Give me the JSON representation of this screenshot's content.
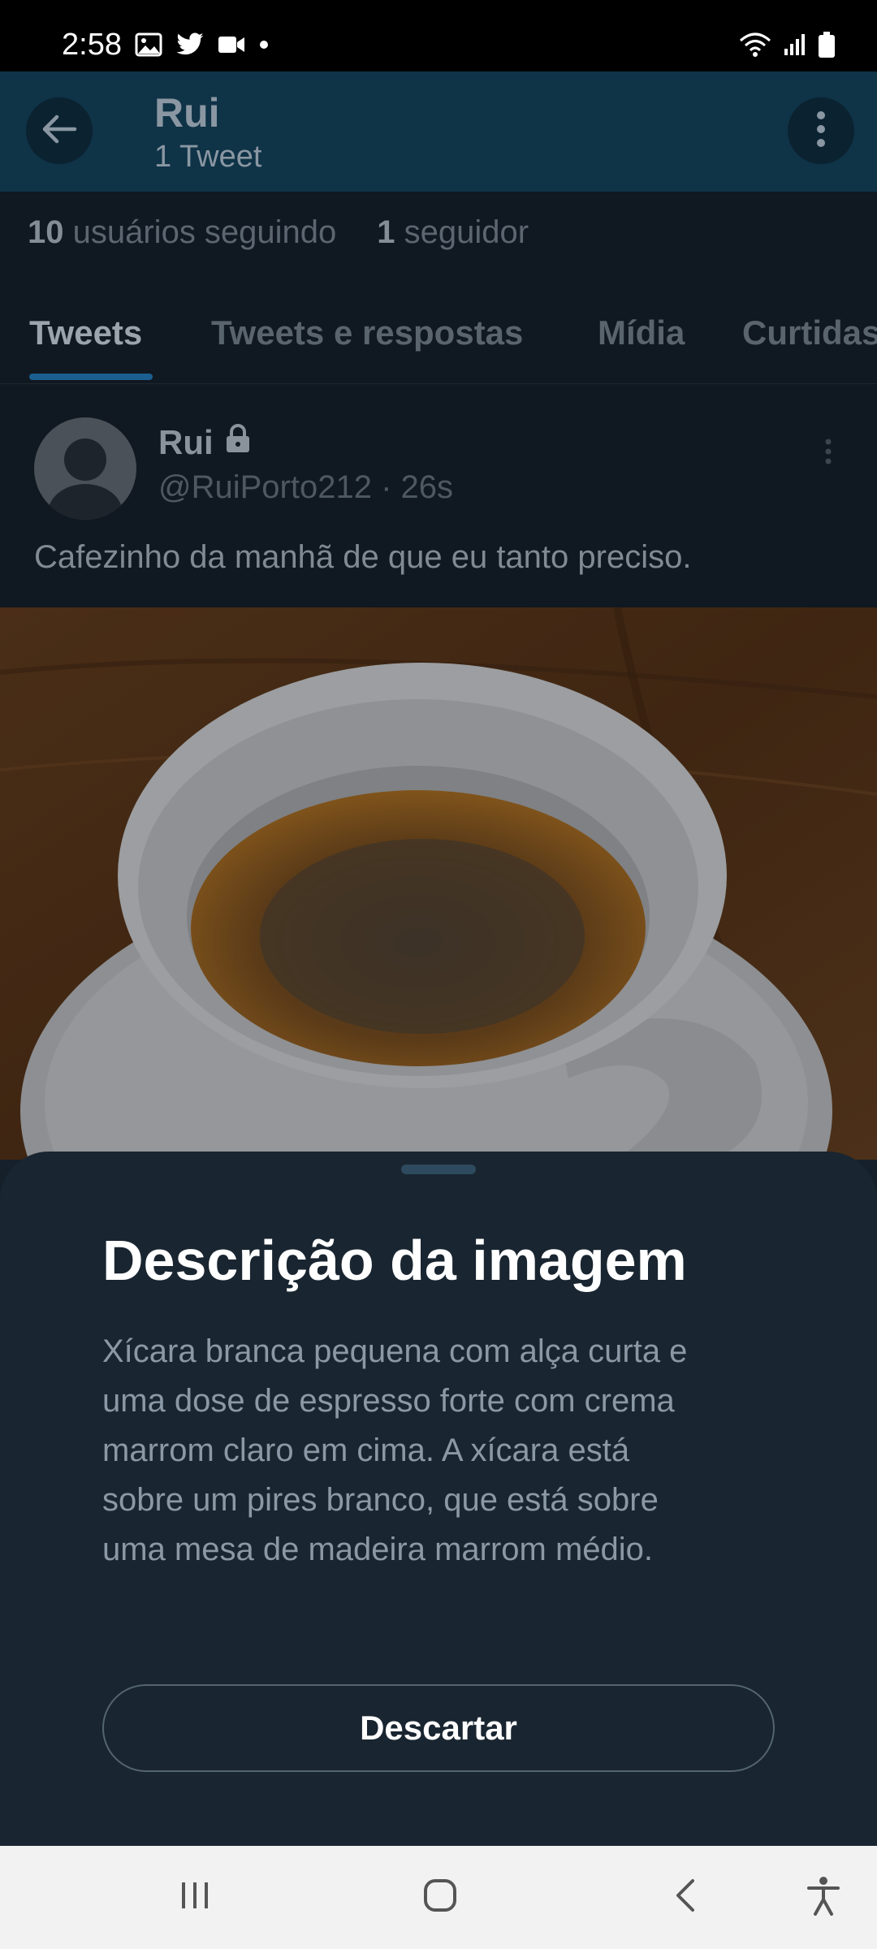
{
  "status_bar": {
    "time": "2:58",
    "left_icons": [
      "gallery-icon",
      "twitter-icon",
      "video-icon",
      "dot-icon"
    ],
    "right_icons": [
      "wifi-icon",
      "signal-icon",
      "battery-icon"
    ]
  },
  "app_bar": {
    "back_icon": "arrow-left-icon",
    "title": "Rui",
    "subtitle": "1 Tweet",
    "more_icon": "more-vertical-icon"
  },
  "profile": {
    "following_count": "10",
    "following_label": "usuários seguindo",
    "followers_count": "1",
    "followers_label": "seguidor"
  },
  "tabs": [
    {
      "label": "Tweets",
      "active": true
    },
    {
      "label": "Tweets e respostas",
      "active": false
    },
    {
      "label": "Mídia",
      "active": false
    },
    {
      "label": "Curtidas",
      "active": false
    }
  ],
  "tweet": {
    "name": "Rui",
    "handle_time": "@RuiPorto212 · 26s",
    "text": "Cafezinho da manhã de que eu tanto preciso.",
    "lock_icon": "lock-icon",
    "more_icon": "more-vertical-icon"
  },
  "sheet": {
    "title": "Descrição da imagem",
    "body": "Xícara branca pequena com alça curta e uma dose de espresso forte com crema marrom claro em cima. A xícara está sobre um pires branco, que está sobre uma mesa de madeira marrom médio.",
    "dismiss_label": "Descartar"
  },
  "nav_bar": {
    "icons": [
      "recent-apps-icon",
      "home-icon",
      "back-icon",
      "accessibility-icon"
    ]
  },
  "colors": {
    "background": "#15202b",
    "sheet": "#192530",
    "app_bar": "#0f3347",
    "accent": "#1d9bf0",
    "muted_text": "#8b98a5"
  }
}
